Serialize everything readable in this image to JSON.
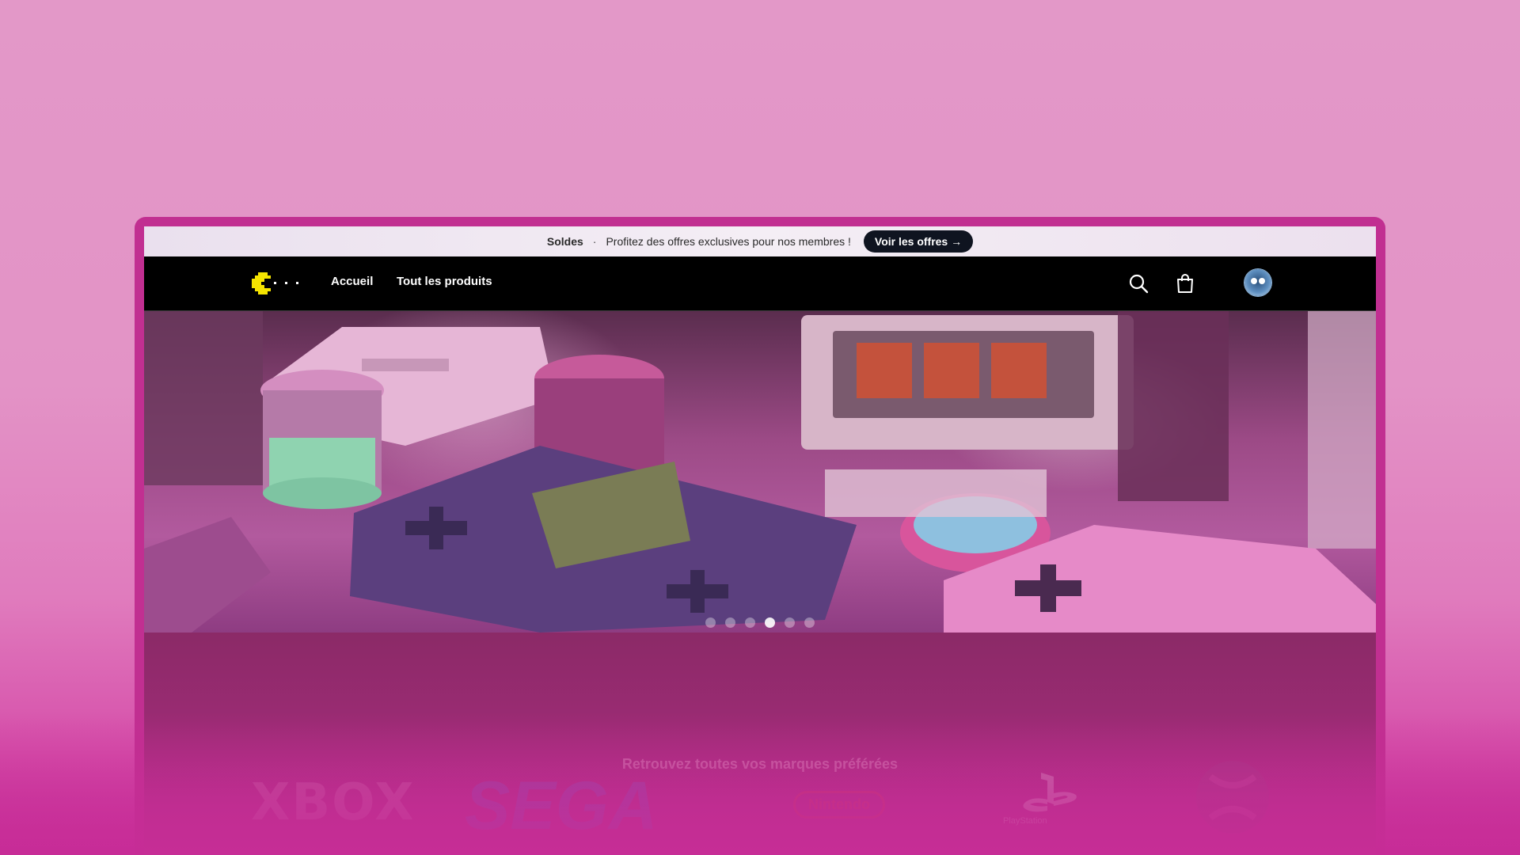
{
  "promo": {
    "title": "Soldes",
    "separator": "·",
    "message": "Profitez des offres exclusives pour nos membres !",
    "cta_label": "Voir les offres →"
  },
  "nav": {
    "home_label": "Accueil",
    "all_products_label": "Tout les produits",
    "logo_icon": "pacman-logo-icon",
    "search_icon": "search-icon",
    "cart_icon": "shopping-bag-icon",
    "avatar_icon": "user-avatar"
  },
  "hero": {
    "slide_count": 6,
    "active_slide": 4
  },
  "brands": {
    "title": "Retrouvez toutes vos marques préférées",
    "items": [
      "XBOX",
      "SEGA",
      "Nintendo",
      "PlayStation",
      "Xbox"
    ]
  },
  "colors": {
    "accent": "#c12f91",
    "nav_bg": "#000000",
    "cta_bg": "#0f1420"
  }
}
